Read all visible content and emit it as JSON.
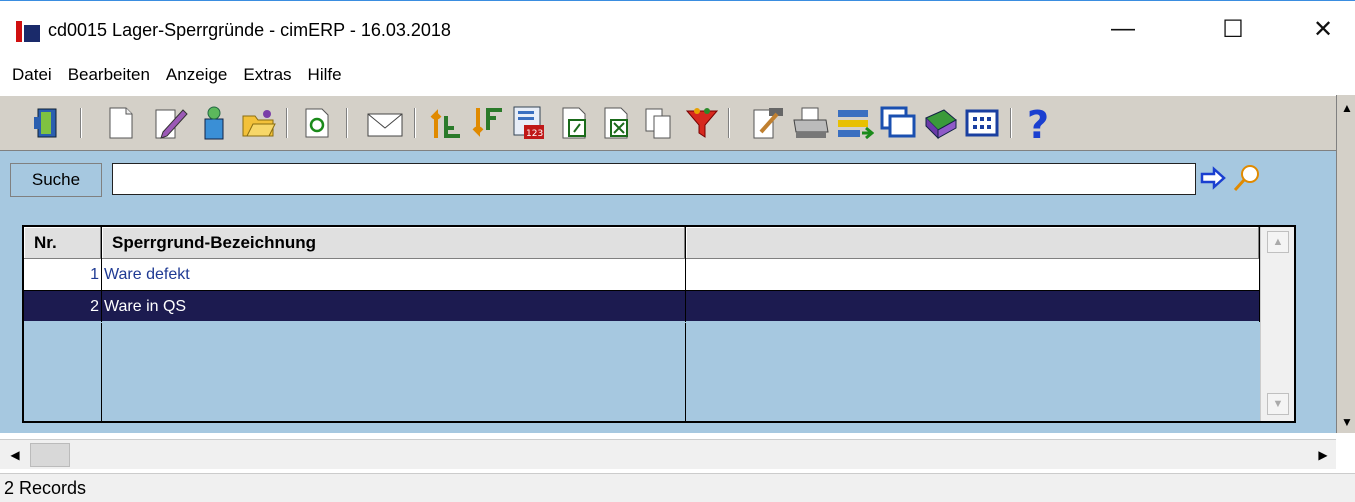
{
  "window": {
    "title": "cd0015 Lager-Sperrgründe - cimERP - 16.03.2018",
    "min_glyph": "—",
    "max_glyph": "☐",
    "close_glyph": "✕"
  },
  "menu": [
    "Datei",
    "Bearbeiten",
    "Anzeige",
    "Extras",
    "Hilfe"
  ],
  "toolbar": {
    "icons": [
      "exit-door-icon",
      "new-document-icon",
      "edit-pencil-icon",
      "recycle-icon",
      "open-folder-icon",
      "refresh-icon",
      "mail-icon",
      "sort-ascending-icon",
      "sort-descending-icon",
      "numeric-list-icon",
      "export-icon",
      "excel-icon",
      "copy-icon",
      "filter-funnel-icon",
      "properties-icon",
      "print-icon",
      "transfer-icon",
      "windows-icon",
      "book-icon",
      "grid-view-icon",
      "help-icon"
    ]
  },
  "search": {
    "label": "Suche",
    "value": ""
  },
  "grid": {
    "columns": [
      "Nr.",
      "Sperrgrund-Bezeichnung",
      ""
    ],
    "rows": [
      {
        "nr": "1",
        "bezeichnung": "Ware defekt",
        "extra": "",
        "selected": false
      },
      {
        "nr": "2",
        "bezeichnung": "Ware in QS",
        "extra": "",
        "selected": true
      }
    ]
  },
  "status": {
    "text": "2 Records"
  },
  "colors": {
    "panel": "#a6c8e0",
    "selection": "#1c1b50",
    "row_text": "#1f3a93"
  }
}
